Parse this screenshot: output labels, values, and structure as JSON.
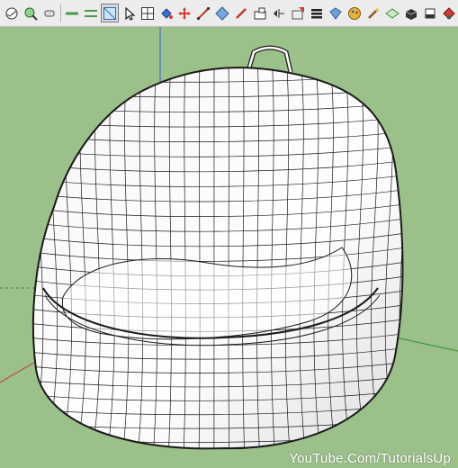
{
  "toolbar": {
    "tools": [
      {
        "name": "orbit",
        "icon": "orbit-icon"
      },
      {
        "name": "zoom",
        "icon": "zoom-icon"
      },
      {
        "name": "eraser",
        "icon": "eraser-icon"
      },
      {
        "name": "line-style-1",
        "icon": "line-style-icon"
      },
      {
        "name": "line-style-2",
        "icon": "line-style-icon"
      },
      {
        "name": "select-box",
        "icon": "select-box-icon"
      },
      {
        "name": "pointer",
        "icon": "pointer-icon"
      },
      {
        "name": "grid",
        "icon": "grid-icon"
      },
      {
        "name": "paint-bucket",
        "icon": "paint-bucket-icon"
      },
      {
        "name": "move",
        "icon": "move-icon"
      },
      {
        "name": "line",
        "icon": "line-icon"
      },
      {
        "name": "push-pull",
        "icon": "push-pull-icon"
      },
      {
        "name": "pencil",
        "icon": "pencil-icon"
      },
      {
        "name": "tape",
        "icon": "tape-icon"
      },
      {
        "name": "follow-me",
        "icon": "follow-me-icon"
      },
      {
        "name": "drape",
        "icon": "drape-icon"
      },
      {
        "name": "layers",
        "icon": "layers-icon"
      },
      {
        "name": "sandbox",
        "icon": "sandbox-icon"
      },
      {
        "name": "styles",
        "icon": "styles-icon"
      },
      {
        "name": "wand",
        "icon": "wand-icon"
      },
      {
        "name": "plane",
        "icon": "plane-icon"
      },
      {
        "name": "extrude",
        "icon": "extrude-icon"
      },
      {
        "name": "eraser-2",
        "icon": "eraser-icon"
      },
      {
        "name": "stamp",
        "icon": "stamp-icon"
      }
    ]
  },
  "viewport": {
    "background_color": "#9cc08a",
    "model_fill": "#ffffff",
    "edge_color": "#1a1a1a"
  },
  "watermark": "YouTube.Com/TutorialsUp"
}
